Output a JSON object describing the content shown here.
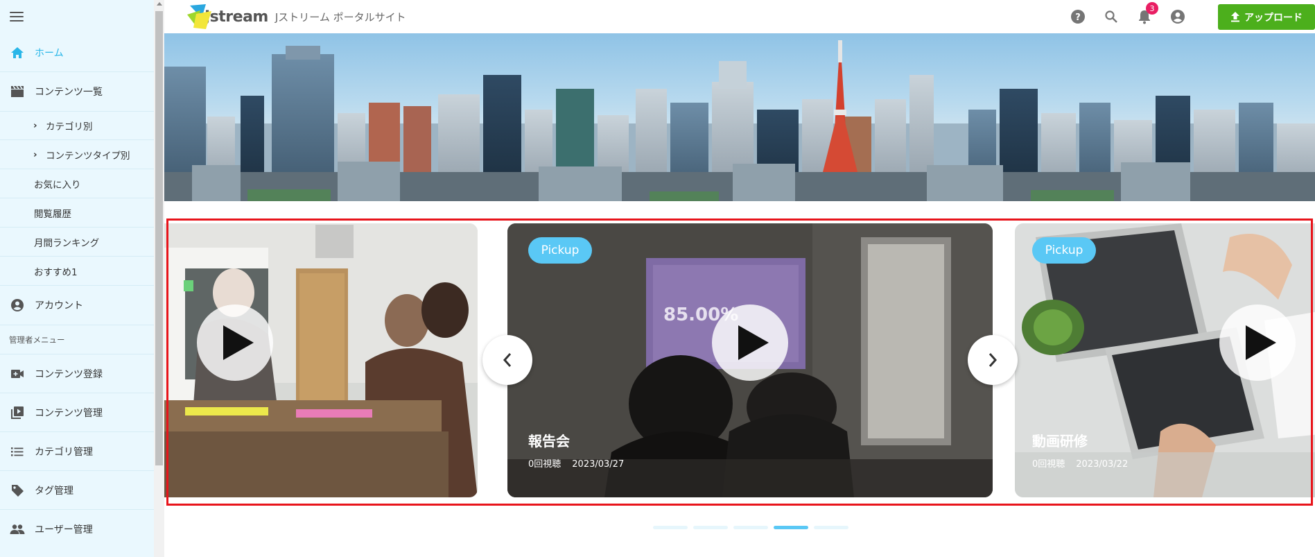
{
  "header": {
    "logo_text": "Jstream",
    "site_name": "Jストリーム ポータルサイト",
    "notification_count": "3",
    "upload_label": "アップロード",
    "icons": [
      "help-icon",
      "search-icon",
      "bell-icon",
      "account-icon",
      "upload-icon"
    ]
  },
  "sidebar": {
    "home": "ホーム",
    "contents": "コンテンツ一覧",
    "by_category": "カテゴリ別",
    "by_type": "コンテンツタイプ別",
    "favorites": "お気に入り",
    "history": "閲覧履歴",
    "ranking": "月間ランキング",
    "recommend": "おすすめ1",
    "account": "アカウント",
    "admin_section": "管理者メニュー",
    "content_register": "コンテンツ登録",
    "content_manage": "コンテンツ管理",
    "category_manage": "カテゴリ管理",
    "tag_manage": "タグ管理",
    "user_manage": "ユーザー管理"
  },
  "carousel": {
    "cards": [
      {
        "badge": "",
        "title": "",
        "views": "",
        "date": ""
      },
      {
        "badge": "Pickup",
        "title": "報告会",
        "views": "0回視聴",
        "date": "2023/03/27"
      },
      {
        "badge": "Pickup",
        "title": "動画研修",
        "views": "0回視聴",
        "date": "2023/03/22"
      }
    ],
    "dots": 5,
    "active_dot": 3
  },
  "colors": {
    "accent": "#29b6e8",
    "upload_button": "#4caf1c",
    "badge": "#e91e63",
    "highlight_box": "#e8141b"
  }
}
